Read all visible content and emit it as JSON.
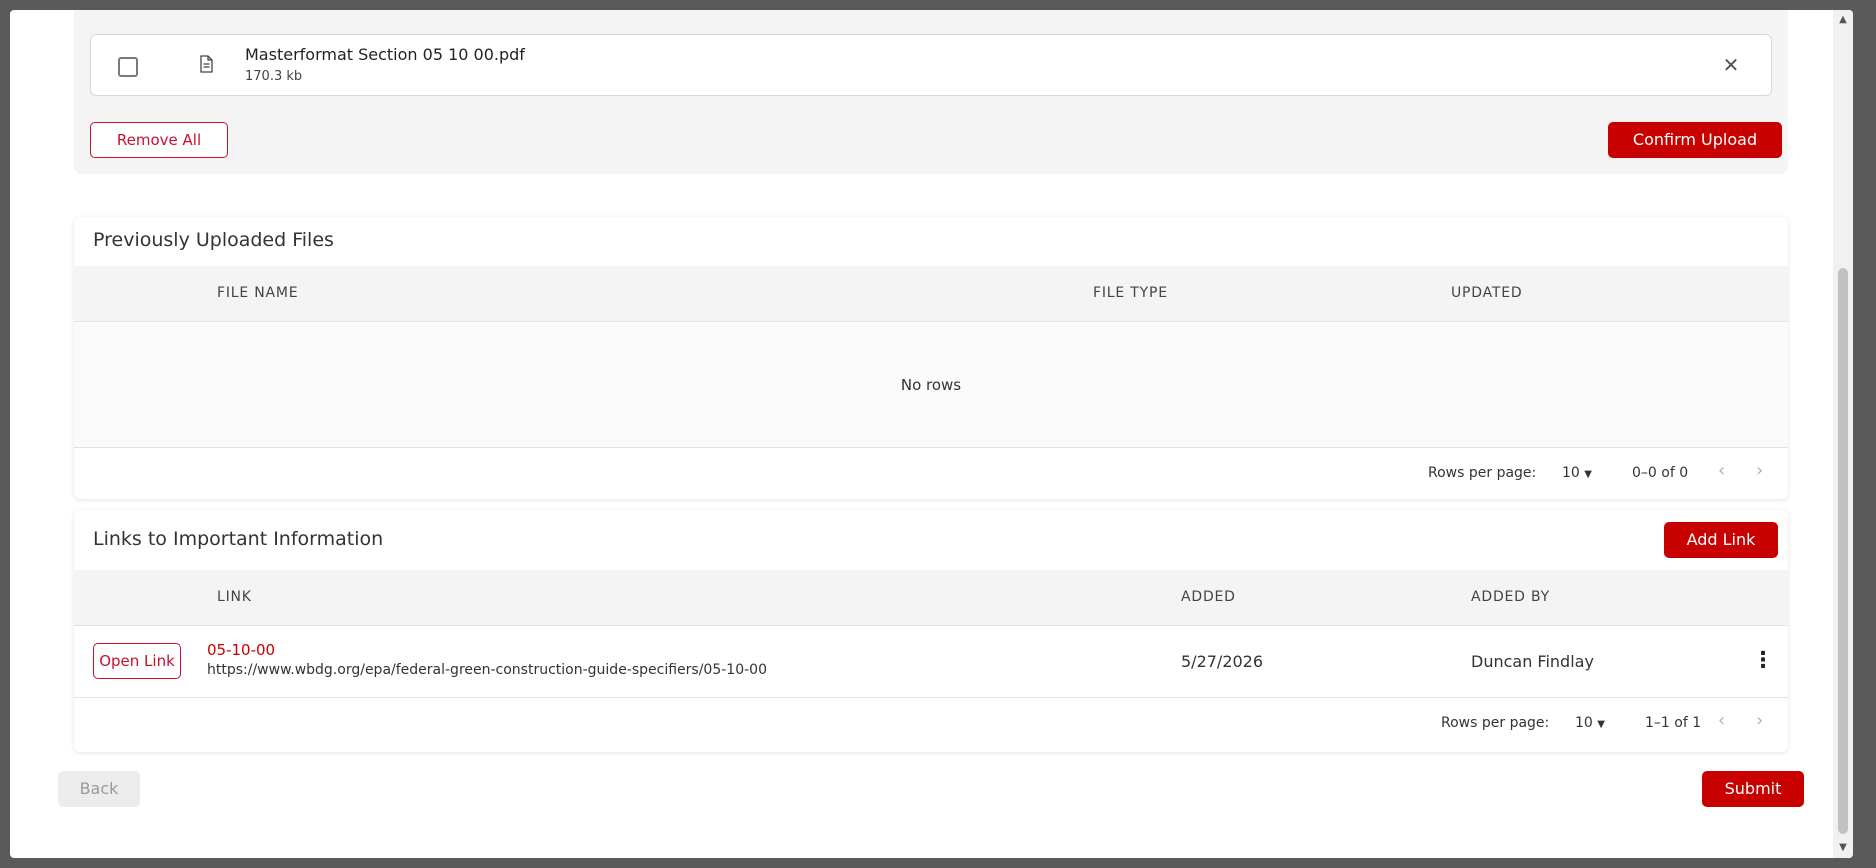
{
  "upload": {
    "file_name": "Masterformat Section 05 10 00.pdf",
    "file_size": "170.3 kb",
    "remove_all_label": "Remove All",
    "confirm_label": "Confirm Upload"
  },
  "previous_files": {
    "title": "Previously Uploaded Files",
    "columns": [
      "FILE NAME",
      "FILE TYPE",
      "UPDATED"
    ],
    "empty_text": "No rows",
    "pager": {
      "rows_per_page_label": "Rows per page:",
      "rows_per_page": "10",
      "range": "0–0 of 0"
    }
  },
  "links": {
    "title": "Links to Important Information",
    "add_label": "Add Link",
    "columns": [
      "LINK",
      "ADDED",
      "ADDED BY"
    ],
    "rows": [
      {
        "open_label": "Open Link",
        "title": "05-10-00",
        "url": "https://www.wbdg.org/epa/federal-green-construction-guide-specifiers/05-10-00",
        "added": "5/27/2026",
        "added_by": "Duncan Findlay"
      }
    ],
    "pager": {
      "rows_per_page_label": "Rows per page:",
      "rows_per_page": "10",
      "range": "1–1 of 1"
    }
  },
  "footer": {
    "back_label": "Back",
    "submit_label": "Submit"
  },
  "colors": {
    "accent": "#c80000",
    "panel": "#f4f4f4"
  },
  "icons": {
    "file": "file-document-icon",
    "close": "close-icon",
    "dropdown": "caret-down-icon",
    "prev": "chevron-left-icon",
    "next": "chevron-right-icon",
    "more": "more-vertical-icon"
  }
}
